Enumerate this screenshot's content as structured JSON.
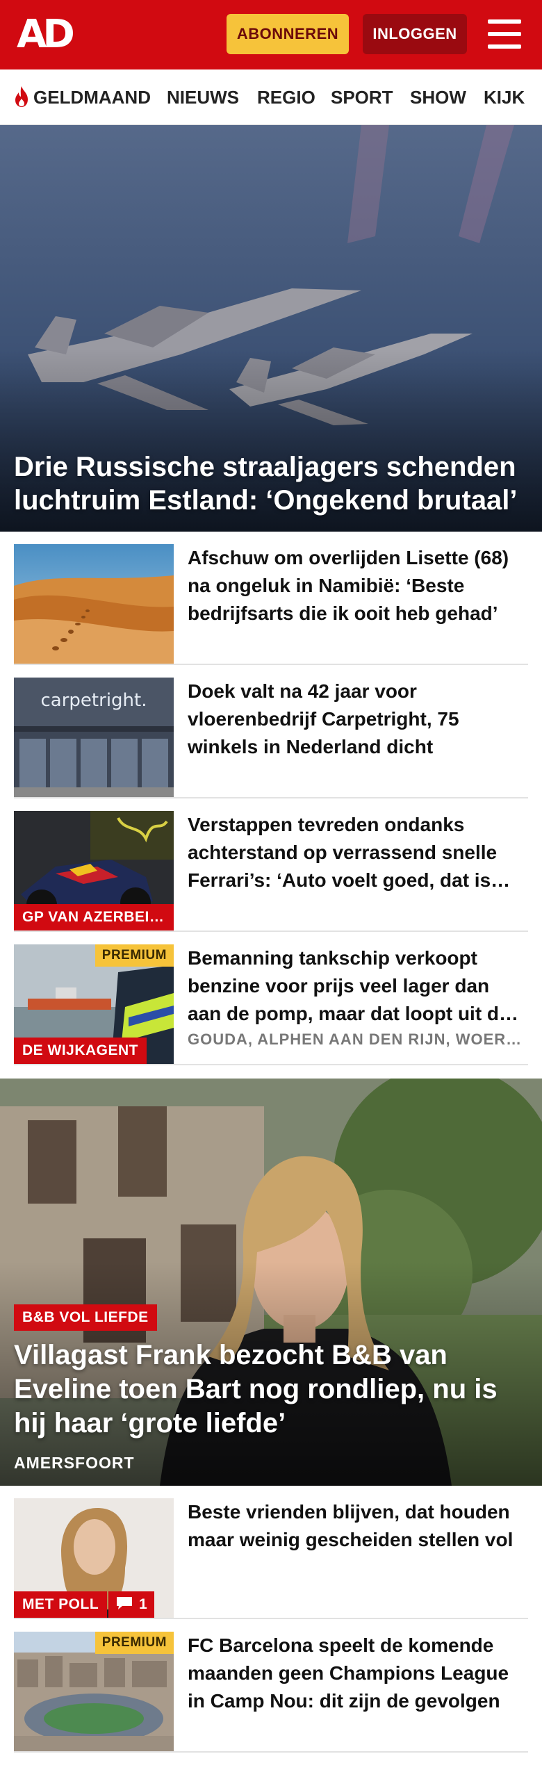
{
  "header": {
    "logo": "AD",
    "subscribe_label": "ABONNEREN",
    "login_label": "INLOGGEN"
  },
  "nav": {
    "items": [
      "GELDMAAND",
      "NIEUWS",
      "REGIO",
      "SPORT",
      "SHOW",
      "KIJK"
    ],
    "highlight_icon": "flame-icon"
  },
  "hero": {
    "title": "Drie Russische straaljagers schenden luchtruim Estland: ‘Ongekend brutaal’"
  },
  "articles": [
    {
      "title": "Afschuw om overlijden Lisette (68) na ongeluk in Namibië: ‘Beste bedrijfsarts die ik ooit heb gehad’"
    },
    {
      "title": "Doek valt na 42 jaar voor vloerenbedrijf Carpetright, 75 winkels in Nederland dicht",
      "thumb_text": "carpetright."
    },
    {
      "title": "Verstappen tevreden ondanks achterstand op verrassend snelle Ferrari’s: ‘Auto voelt goed, dat is belangrijk’",
      "label": "GP VAN AZERBEIDZJAN"
    },
    {
      "title": "Bemanning tankschip verkoopt benzine voor prijs veel lager dan aan de pomp, maar dat loopt uit de hand",
      "label": "DE WIJKAGENT",
      "premium": "PREMIUM",
      "meta": "GOUDA, ALPHEN AAN DEN RIJN, WOERDEN"
    }
  ],
  "feature": {
    "tag": "B&B VOL LIEFDE",
    "title": "Villagast Frank bezocht B&B van Eveline toen Bart nog rondliep, nu is hij haar ‘grote liefde’",
    "location": "AMERSFOORT"
  },
  "articles2": [
    {
      "title": "Beste vrienden blijven, dat houden maar weinig gescheiden stellen vol",
      "label": "MET POLL",
      "comments": "1"
    },
    {
      "title": "FC Barcelona speelt de komende maanden geen Champions League in Camp Nou: dit zijn de gevolgen",
      "premium": "PREMIUM"
    }
  ],
  "colors": {
    "brand_red": "#d10a11",
    "premium_yellow": "#f6c33a",
    "login_dark_red": "#9a0a10"
  }
}
